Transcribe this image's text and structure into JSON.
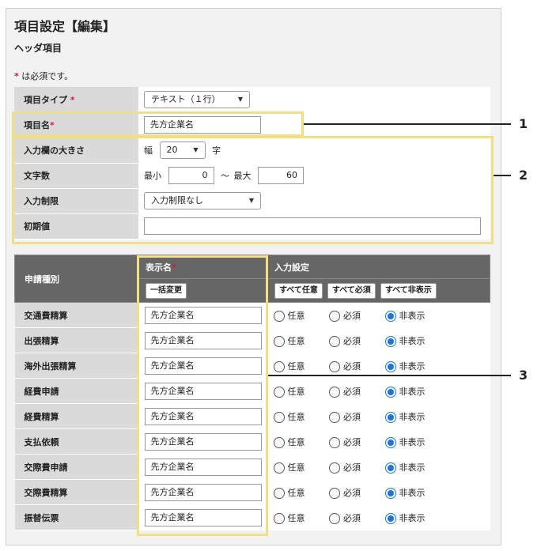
{
  "page": {
    "title": "項目設定【編集】",
    "section_title": "ヘッダ項目",
    "required_mark": "*",
    "required_note": " は必須です。"
  },
  "header_fields": {
    "item_type": {
      "label": "項目タイプ",
      "value": "テキスト（１行）"
    },
    "item_name": {
      "label": "項目名",
      "value": "先方企業名"
    },
    "field_size": {
      "label": "入力欄の大きさ",
      "prefix": "幅",
      "value": "20",
      "suffix": "字"
    },
    "char_count": {
      "label": "文字数",
      "min_label": "最小",
      "min_value": "0",
      "separator": "〜",
      "max_label": "最大",
      "max_value": "60"
    },
    "input_restriction": {
      "label": "入力制限",
      "value": "入力制限なし"
    },
    "initial_value": {
      "label": "初期値",
      "value": ""
    }
  },
  "table": {
    "col_type": "申請種別",
    "col_display_name": "表示名",
    "col_input_setting": "入力設定",
    "bulk_change_button": "一括変更",
    "all_optional_button": "すべて任意",
    "all_required_button": "すべて必須",
    "all_hidden_button": "すべて非表示",
    "option_labels": {
      "optional": "任意",
      "required": "必須",
      "hidden": "非表示"
    },
    "rows": [
      {
        "type": "交通費精算",
        "display_name": "先方企業名",
        "selected": "hidden"
      },
      {
        "type": "出張精算",
        "display_name": "先方企業名",
        "selected": "hidden"
      },
      {
        "type": "海外出張精算",
        "display_name": "先方企業名",
        "selected": "hidden"
      },
      {
        "type": "経費申請",
        "display_name": "先方企業名",
        "selected": "hidden"
      },
      {
        "type": "経費精算",
        "display_name": "先方企業名",
        "selected": "hidden"
      },
      {
        "type": "支払依頼",
        "display_name": "先方企業名",
        "selected": "hidden"
      },
      {
        "type": "交際費申請",
        "display_name": "先方企業名",
        "selected": "hidden"
      },
      {
        "type": "交際費精算",
        "display_name": "先方企業名",
        "selected": "hidden"
      },
      {
        "type": "振替伝票",
        "display_name": "先方企業名",
        "selected": "hidden"
      }
    ]
  },
  "callouts": {
    "one": "1",
    "two": "2",
    "three": "3"
  },
  "colors": {
    "highlight": "#f0df86",
    "radio_selected": "#1a73e8",
    "required_mark": "#e0162b",
    "header_bg": "#666666",
    "label_bg": "#dadada"
  }
}
